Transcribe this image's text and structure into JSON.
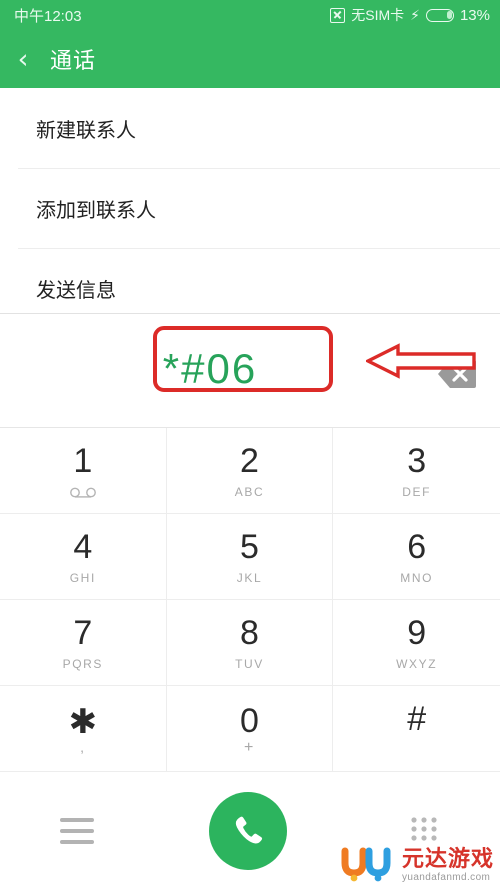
{
  "status_bar": {
    "time": "中午12:03",
    "nosim_icon": "no-sim-icon",
    "sim_text": "无SIM卡",
    "charging_icon": "⚡",
    "battery_icon": "battery-icon",
    "battery_percent": "13%"
  },
  "app_bar": {
    "back_icon": "‹",
    "title": "通话"
  },
  "options": [
    {
      "label": "新建联系人"
    },
    {
      "label": "添加到联系人"
    },
    {
      "label": "发送信息"
    }
  ],
  "dialer": {
    "number": "*#06",
    "backspace_icon": "backspace-icon",
    "keys": [
      {
        "digit": "1",
        "sub": "",
        "sub_icon": "voicemail-icon"
      },
      {
        "digit": "2",
        "sub": "ABC",
        "sub_icon": ""
      },
      {
        "digit": "3",
        "sub": "DEF",
        "sub_icon": ""
      },
      {
        "digit": "4",
        "sub": "GHI",
        "sub_icon": ""
      },
      {
        "digit": "5",
        "sub": "JKL",
        "sub_icon": ""
      },
      {
        "digit": "6",
        "sub": "MNO",
        "sub_icon": ""
      },
      {
        "digit": "7",
        "sub": "PQRS",
        "sub_icon": ""
      },
      {
        "digit": "8",
        "sub": "TUV",
        "sub_icon": ""
      },
      {
        "digit": "9",
        "sub": "WXYZ",
        "sub_icon": ""
      },
      {
        "digit": "✱",
        "sub": ",",
        "sub_icon": ""
      },
      {
        "digit": "0",
        "sub": "+",
        "sub_icon": ""
      },
      {
        "digit": "#",
        "sub": "",
        "sub_icon": ""
      }
    ]
  },
  "bottom_bar": {
    "menu_icon": "hamburger-menu-icon",
    "call_icon": "phone-handset-icon",
    "keypad_icon": "dialpad-icon"
  },
  "annotations": {
    "highlight_box": "red-rounded-rectangle-around-number",
    "arrow": "red-left-pointing-arrow"
  },
  "watermark": {
    "brand": "元达游戏",
    "url": "yuandafanmd.com"
  },
  "colors": {
    "header_green": "#35b861",
    "call_button_green": "#2cb45e",
    "number_green": "#27a35a",
    "annotation_red": "#dc2b28",
    "divider_gray": "#ededed"
  }
}
